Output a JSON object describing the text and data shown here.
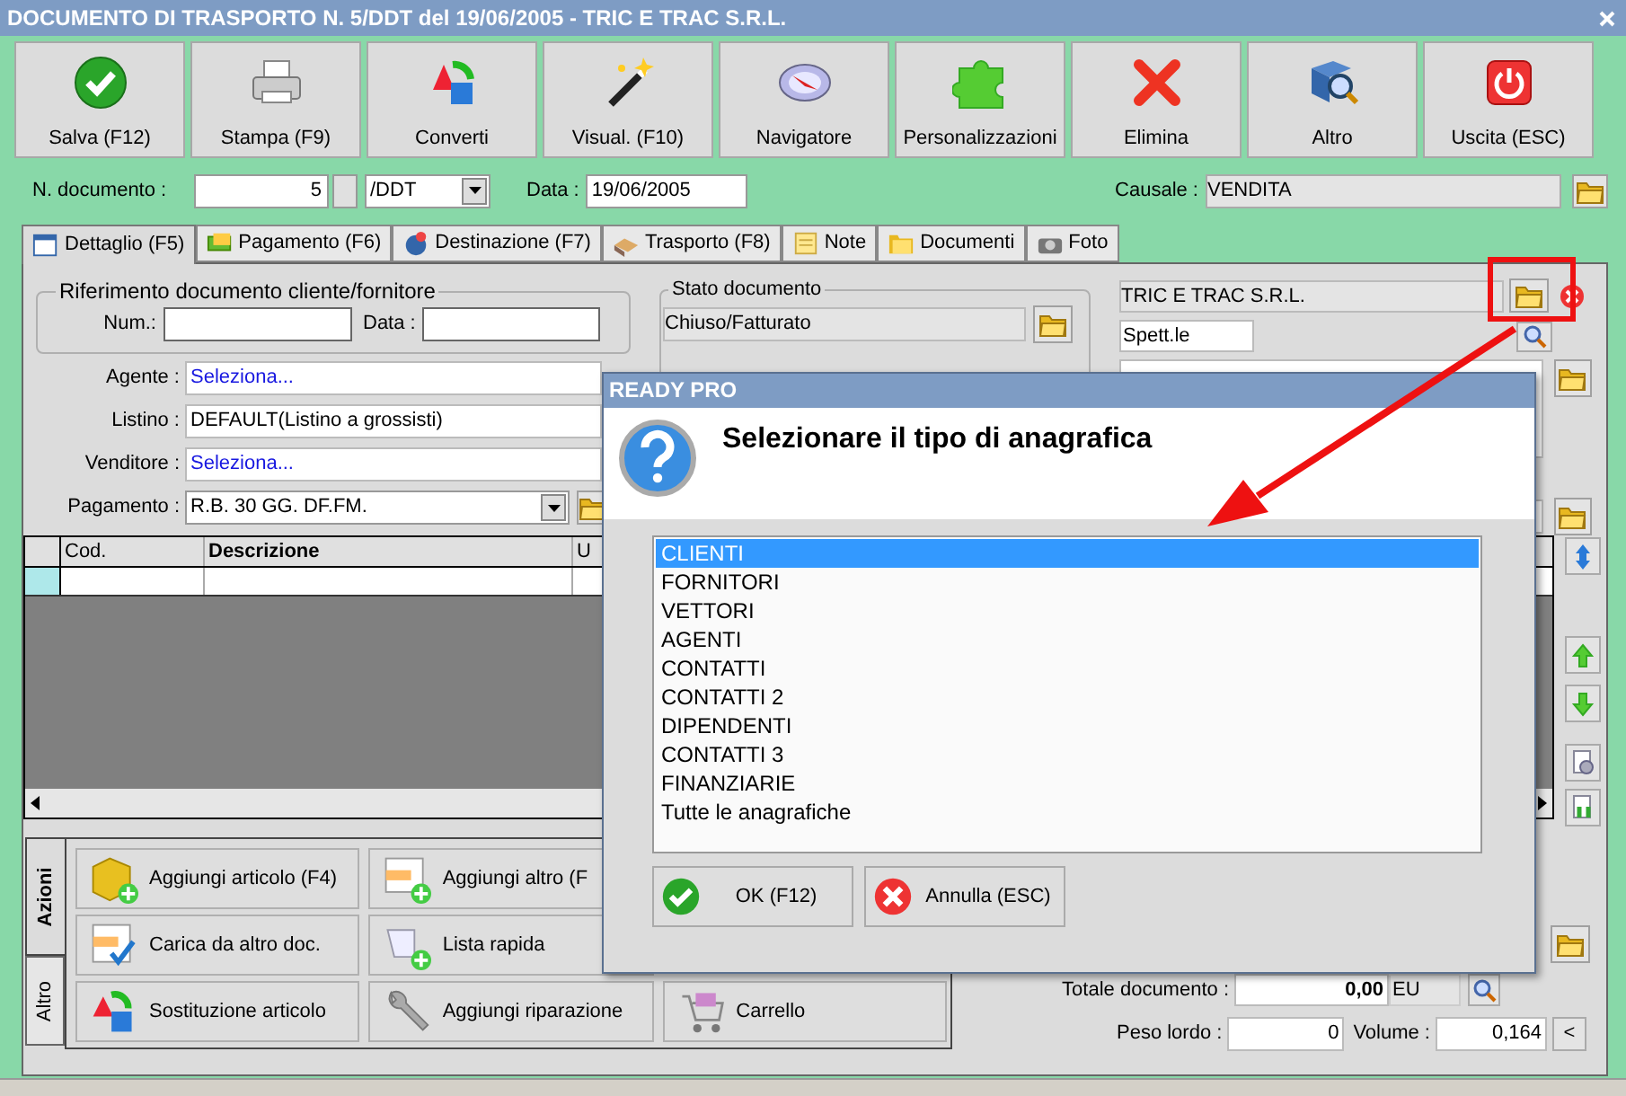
{
  "window": {
    "title": "DOCUMENTO DI TRASPORTO N. 5/DDT del 19/06/2005 - TRIC E TRAC S.R.L."
  },
  "toolbar": [
    {
      "label": "Salva (F12)"
    },
    {
      "label": "Stampa (F9)"
    },
    {
      "label": "Converti"
    },
    {
      "label": "Visual. (F10)"
    },
    {
      "label": "Navigatore"
    },
    {
      "label": "Personalizzazioni"
    },
    {
      "label": "Elimina"
    },
    {
      "label": "Altro"
    },
    {
      "label": "Uscita (ESC)"
    }
  ],
  "header": {
    "doc_number_label": "N. documento :",
    "doc_number": "5",
    "series": "/DDT",
    "date_label": "Data :",
    "date": "19/06/2005",
    "causale_label": "Causale :",
    "causale": "VENDITA"
  },
  "tabs": [
    {
      "label": "Dettaglio (F5)",
      "selected": true
    },
    {
      "label": "Pagamento (F6)",
      "selected": false
    },
    {
      "label": "Destinazione (F7)",
      "selected": false
    },
    {
      "label": "Trasporto (F8)",
      "selected": false
    },
    {
      "label": "Note",
      "selected": false
    },
    {
      "label": "Documenti",
      "selected": false
    },
    {
      "label": "Foto",
      "selected": false
    }
  ],
  "reference": {
    "title": "Riferimento documento cliente/fornitore",
    "num_label": "Num.:",
    "date_label": "Data :"
  },
  "fields": [
    {
      "label": "Agente :",
      "value": "Seleziona...",
      "kind": "link"
    },
    {
      "label": "Listino :",
      "value": "DEFAULT(Listino a grossisti)",
      "kind": "text"
    },
    {
      "label": "Venditore :",
      "value": "Seleziona...",
      "kind": "link"
    },
    {
      "label": "Pagamento :",
      "value": "R.B. 30 GG. DF.FM.",
      "kind": "dropdown"
    }
  ],
  "status": {
    "title": "Stato documento",
    "value": "Chiuso/Fatturato"
  },
  "customer": {
    "name": "TRIC E TRAC S.R.L.",
    "salutation": "Spett.le"
  },
  "grid": {
    "columns": [
      "Cod.",
      "Descrizione",
      "U"
    ]
  },
  "action_tabs": [
    {
      "label": "Azioni",
      "selected": true
    },
    {
      "label": "Altro",
      "selected": false
    }
  ],
  "actions": [
    {
      "label": "Aggiungi articolo (F4)"
    },
    {
      "label": "Aggiungi altro (F"
    },
    {
      "label": "Carica da altro doc."
    },
    {
      "label": "Lista rapida"
    },
    {
      "label": "Sostituzione articolo"
    },
    {
      "label": "Aggiungi riparazione"
    },
    {
      "label": "Carrello"
    }
  ],
  "totals": {
    "total_label": "Totale documento :",
    "total": "0,00",
    "currency": "EU",
    "weight_label": "Peso lordo :",
    "weight": "0",
    "volume_label": "Volume :",
    "volume": "0,164",
    "collapse_button": "<"
  },
  "dialog": {
    "title": "READY PRO",
    "message": "Selezionare il tipo di anagrafica",
    "options": [
      {
        "label": "CLIENTI",
        "selected": true
      },
      {
        "label": "FORNITORI",
        "selected": false
      },
      {
        "label": "VETTORI",
        "selected": false
      },
      {
        "label": "AGENTI",
        "selected": false
      },
      {
        "label": "CONTATTI",
        "selected": false
      },
      {
        "label": "CONTATTI 2",
        "selected": false
      },
      {
        "label": "DIPENDENTI",
        "selected": false
      },
      {
        "label": "CONTATTI 3",
        "selected": false
      },
      {
        "label": "FINANZIARIE",
        "selected": false
      },
      {
        "label": "Tutte le anagrafiche",
        "selected": false
      }
    ],
    "buttons": [
      {
        "label": "OK (F12)"
      },
      {
        "label": "Annulla (ESC)"
      }
    ]
  }
}
